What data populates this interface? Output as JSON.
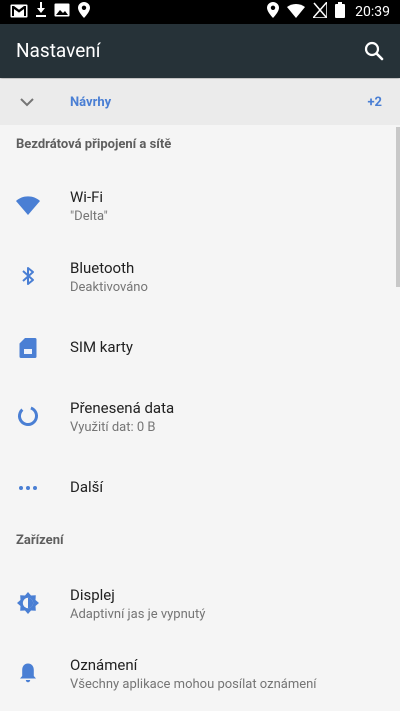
{
  "status_bar": {
    "time": "20:39",
    "left_icons": [
      "gmail-icon",
      "download-icon",
      "image-icon",
      "location-icon"
    ],
    "right_icons": [
      "location-icon",
      "wifi-icon",
      "no-signal-icon",
      "battery-icon"
    ]
  },
  "app_bar": {
    "title": "Nastavení",
    "search_icon": "search-icon"
  },
  "suggestions": {
    "label": "Návrhy",
    "count": "+2"
  },
  "sections": [
    {
      "header": "Bezdrátová připojení a sítě",
      "items": [
        {
          "title": "Wi‑Fi",
          "summary": "\"Delta\"",
          "icon": "wifi-icon"
        },
        {
          "title": "Bluetooth",
          "summary": "Deaktivováno",
          "icon": "bluetooth-icon"
        },
        {
          "title": "SIM karty",
          "summary": "",
          "icon": "sim-card-icon"
        },
        {
          "title": "Přenesená data",
          "summary": "Využití dat: 0 B",
          "icon": "data-usage-icon"
        },
        {
          "title": "Další",
          "summary": "",
          "icon": "more-icon"
        }
      ]
    },
    {
      "header": "Zařízení",
      "items": [
        {
          "title": "Displej",
          "summary": "Adaptivní jas je vypnutý",
          "icon": "brightness-icon"
        },
        {
          "title": "Oznámení",
          "summary": "Všechny aplikace mohou posílat oznámení",
          "icon": "notifications-icon"
        }
      ]
    }
  ],
  "colors": {
    "accent": "#4a7fd4",
    "app_bar": "#263238",
    "background": "#f5f5f5"
  }
}
